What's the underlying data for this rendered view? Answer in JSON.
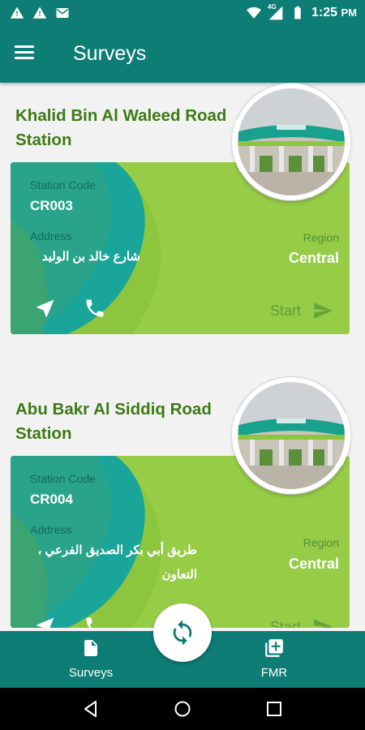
{
  "status_bar": {
    "time": "1:25",
    "ampm": "PM",
    "network": "4G",
    "icons": [
      "alert-icon",
      "alert-icon",
      "mail-icon",
      "wifi-icon",
      "signal-icon",
      "battery-icon"
    ]
  },
  "app_bar": {
    "title": "Surveys",
    "menu_icon": "menu-icon"
  },
  "stations": [
    {
      "name": "Khalid Bin Al Waleed Road Station",
      "code_label": "Station Code",
      "code": "CR003",
      "address_label": "Address",
      "address": "شارع خالد بن الوليد",
      "region_label": "Region",
      "region": "Central",
      "start_label": "Start"
    },
    {
      "name": "Abu Bakr Al Siddiq Road Station",
      "code_label": "Station Code",
      "code": "CR004",
      "address_label": "Address",
      "address": "طريق أبي بكر الصديق الفرعي ، التعاون",
      "region_label": "Region",
      "region": "Central",
      "start_label": "Start"
    }
  ],
  "bottom_nav": {
    "items": [
      {
        "label": "Surveys",
        "icon": "document-icon"
      },
      {
        "label": "FMR",
        "icon": "add-library-icon"
      }
    ],
    "fab_icon": "sync-icon"
  },
  "colors": {
    "primary": "#0d7d75",
    "card_green": "#8cc63f",
    "card_teal": "#1aa59a",
    "title_green": "#3d7a16"
  }
}
